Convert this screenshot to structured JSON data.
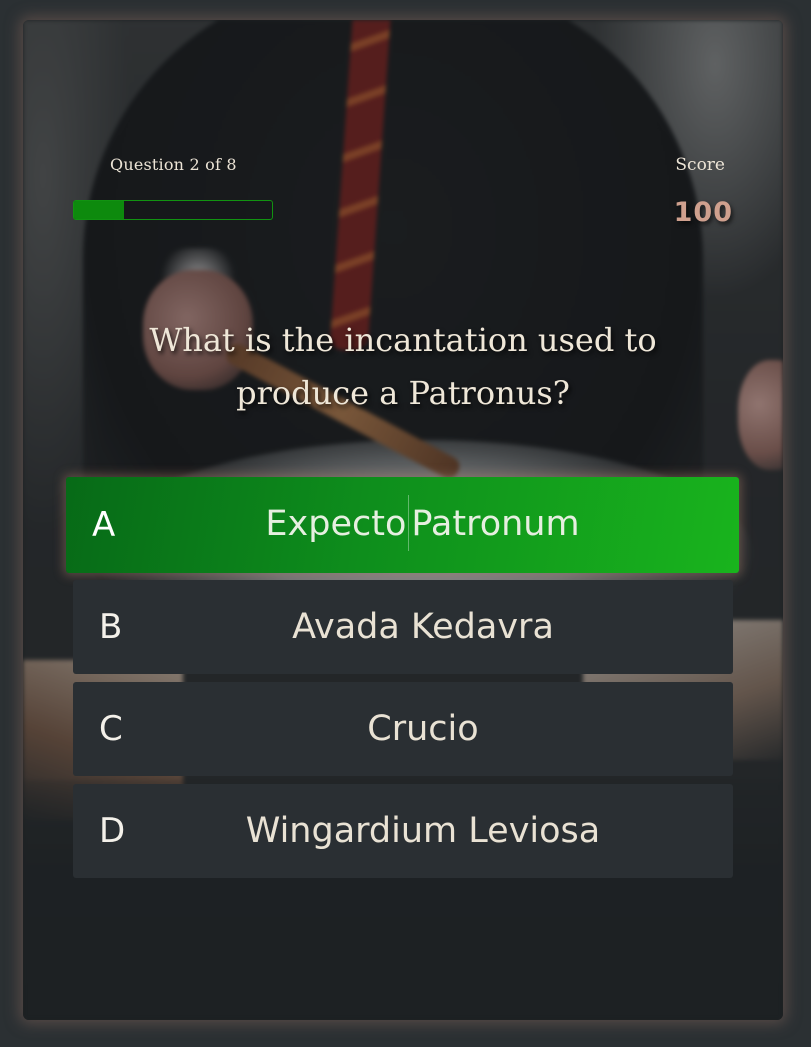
{
  "hud": {
    "question_counter": "Question 2 of 8",
    "progress_fraction": 0.25,
    "score_label": "Score",
    "score_value": "100"
  },
  "question": {
    "text": "What is the incantation used to produce a Patronus?"
  },
  "answers": [
    {
      "letter": "A",
      "text_before_caret": "Expecto",
      "text_after_caret": "Patronum",
      "selected": true
    },
    {
      "letter": "B",
      "text": "Avada Kedavra",
      "selected": false
    },
    {
      "letter": "C",
      "text": "Crucio",
      "selected": false
    },
    {
      "letter": "D",
      "text": "Wingardium Leviosa",
      "selected": false
    }
  ],
  "colors": {
    "accent_green": "#0e8e1c",
    "score_color": "#cfa08e",
    "answer_bg": "#2a2f33"
  }
}
